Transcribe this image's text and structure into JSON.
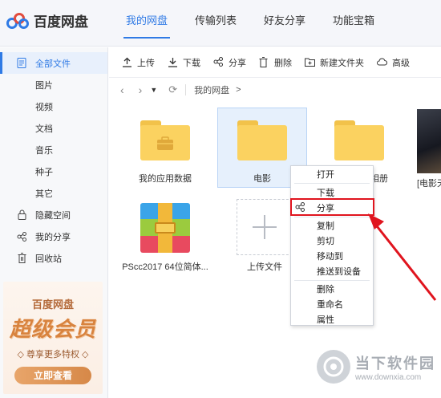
{
  "header": {
    "logo_text": "百度网盘",
    "tabs": [
      {
        "label": "我的网盘",
        "active": true
      },
      {
        "label": "传输列表"
      },
      {
        "label": "好友分享"
      },
      {
        "label": "功能宝箱"
      }
    ]
  },
  "sidebar": {
    "items": [
      {
        "label": "全部文件",
        "icon": "document-icon",
        "active": true
      },
      {
        "label": "图片"
      },
      {
        "label": "视频"
      },
      {
        "label": "文档"
      },
      {
        "label": "音乐"
      },
      {
        "label": "种子"
      },
      {
        "label": "其它"
      },
      {
        "label": "隐藏空间",
        "icon": "lock-icon"
      },
      {
        "label": "我的分享",
        "icon": "share-icon"
      },
      {
        "label": "回收站",
        "icon": "trash-icon"
      }
    ],
    "promo": {
      "brand": "百度网盘",
      "title": "超级会员",
      "subtitle": "◇ 尊享更多特权 ◇",
      "button": "立即查看"
    }
  },
  "toolbar": {
    "upload": "上传",
    "download": "下载",
    "share": "分享",
    "delete": "删除",
    "new_folder": "新建文件夹",
    "more": "高级"
  },
  "breadcrumb": {
    "path": "我的网盘",
    "sep": ">"
  },
  "files": [
    {
      "name": "我的应用数据",
      "type": "folder"
    },
    {
      "name": "电影",
      "type": "folder",
      "selected": true
    },
    {
      "name": "相册",
      "type": "folder"
    },
    {
      "name": "[电影天",
      "type": "video"
    },
    {
      "name": "PScc2017 64位简体...",
      "type": "archive"
    },
    {
      "name": "上传文件",
      "type": "upload"
    }
  ],
  "context_menu": {
    "items": [
      "打开",
      "下载",
      "分享",
      "复制",
      "剪切",
      "移动到",
      "推送到设备",
      "删除",
      "重命名",
      "属性"
    ],
    "highlighted": "分享"
  },
  "watermark": {
    "name": "当下软件园",
    "url": "www.downxia.com"
  },
  "colors": {
    "accent": "#2f7ae5",
    "folder": "#fbd260",
    "highlight": "#e0141e"
  }
}
